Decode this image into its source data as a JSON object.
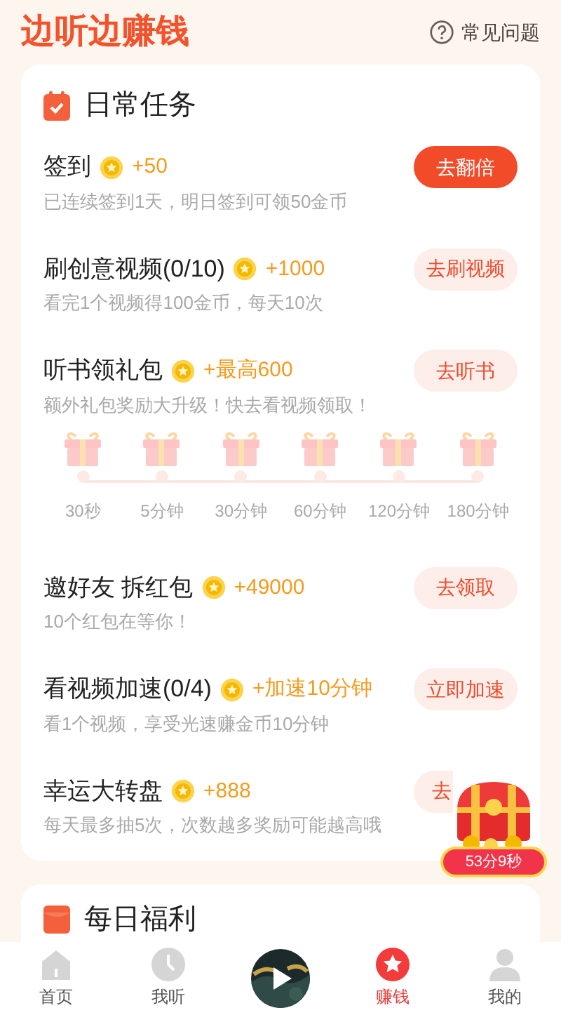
{
  "header": {
    "title": "边听边赚钱",
    "help": "常见问题"
  },
  "daily_tasks": {
    "title": "日常任务",
    "tasks": [
      {
        "kind": "basic",
        "title": "签到",
        "reward": "+50",
        "desc": "已连续签到1天，明日签到可领50金币",
        "button": "去翻倍",
        "primary": true
      },
      {
        "kind": "basic",
        "title": "刷创意视频(0/10)",
        "reward": "+1000",
        "desc": "看完1个视频得100金币，每天10次",
        "button": "去刷视频",
        "primary": false
      },
      {
        "kind": "gift",
        "title": "听书领礼包",
        "reward": "+最高600",
        "desc": "额外礼包奖励大升级！快去看视频领取！",
        "button": "去听书",
        "primary": false,
        "milestones": [
          "30秒",
          "5分钟",
          "30分钟",
          "60分钟",
          "120分钟",
          "180分钟"
        ]
      },
      {
        "kind": "basic",
        "title": "邀好友 拆红包",
        "reward": "+49000",
        "desc": "10个红包在等你！",
        "button": "去领取",
        "primary": false
      },
      {
        "kind": "basic",
        "title": "看视频加速(0/4)",
        "reward": "+加速10分钟",
        "desc": "看1个视频，享受光速赚金币10分钟",
        "button": "立即加速",
        "primary": false
      },
      {
        "kind": "basic",
        "title": "幸运大转盘",
        "reward": "+888",
        "desc": "每天最多抽5次，次数越多奖励可能越高哦",
        "button": "去",
        "primary": false,
        "covered": true
      }
    ]
  },
  "treasure": {
    "timer": "53分9秒"
  },
  "daily_welfare": {
    "title": "每日福利"
  },
  "nav": [
    {
      "kind": "home",
      "label": "首页",
      "selected": false
    },
    {
      "kind": "clock",
      "label": "我听",
      "selected": false
    },
    {
      "kind": "cover"
    },
    {
      "kind": "star",
      "label": "赚钱",
      "selected": true
    },
    {
      "kind": "person",
      "label": "我的",
      "selected": false
    }
  ]
}
